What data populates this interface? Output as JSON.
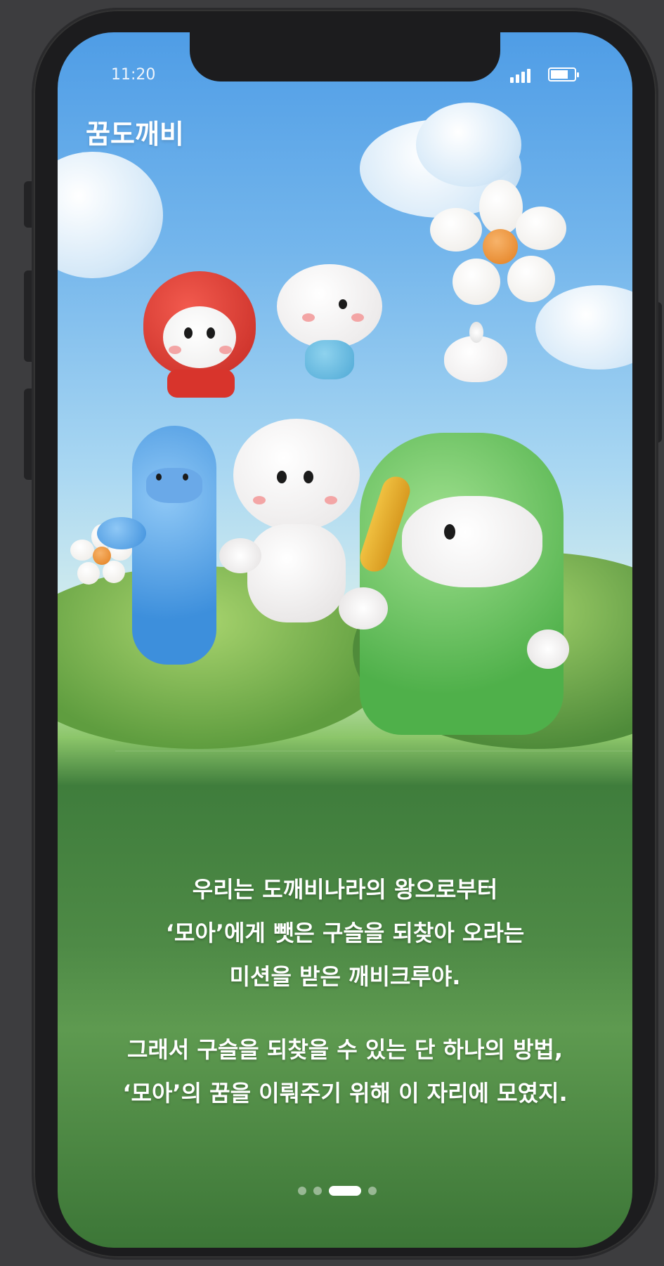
{
  "status_bar": {
    "time": "11:20"
  },
  "header": {
    "app_title": "꿈도깨비"
  },
  "onboarding": {
    "story_paragraph_1": [
      "우리는 도깨비나라의 왕으로부터",
      "‘모아’에게 뺏은 구슬을 되찾아 오라는",
      "미션을 받은 깨비크루야."
    ],
    "story_paragraph_2": [
      "그래서 구슬을 되찾을 수 있는 단 하나의 방법,",
      "‘모아’의 꿈을 이뤄주기 위해 이 자리에 모였지."
    ],
    "pager": {
      "total_pages": 4,
      "current_page": 3
    }
  },
  "colors": {
    "sky_top": "#4f9de6",
    "grass": "#4e8a46",
    "text": "#ffffff",
    "phone_frame": "#1c1c1e"
  },
  "icons": [
    "signal-icon",
    "battery-icon",
    "cloud",
    "daisy-flower",
    "goblin-characters"
  ]
}
